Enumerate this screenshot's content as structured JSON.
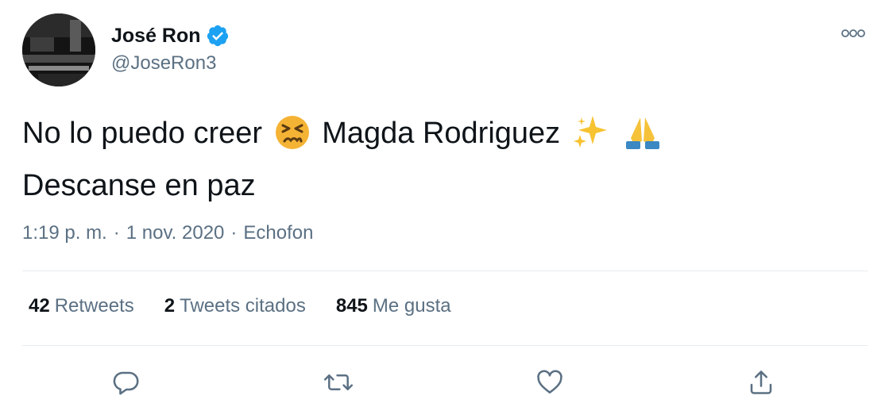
{
  "author": {
    "name": "José Ron",
    "handle": "@JoseRon3",
    "verified": true
  },
  "tweet": {
    "line1_before": "No lo puedo creer",
    "emoji_1": "persevering-face",
    "line1_name": "Magda Rodriguez",
    "emoji_2": "sparkles",
    "emoji_3": "folded-hands",
    "line2": "Descanse en paz"
  },
  "meta": {
    "time": "1:19 p. m.",
    "sep1": "·",
    "date": "1 nov. 2020",
    "sep2": "·",
    "source": "Echofon"
  },
  "stats": {
    "retweets_count": "42",
    "retweets_label": "Retweets",
    "quotes_count": "2",
    "quotes_label": "Tweets citados",
    "likes_count": "845",
    "likes_label": "Me gusta"
  },
  "actions": {
    "reply_icon": "reply-icon",
    "retweet_icon": "retweet-icon",
    "like_icon": "heart-icon",
    "share_icon": "share-icon"
  },
  "colors": {
    "text": "#0f1419",
    "secondary": "#5b7083",
    "divider": "#e6ecf0",
    "verified": "#1da1f2"
  }
}
